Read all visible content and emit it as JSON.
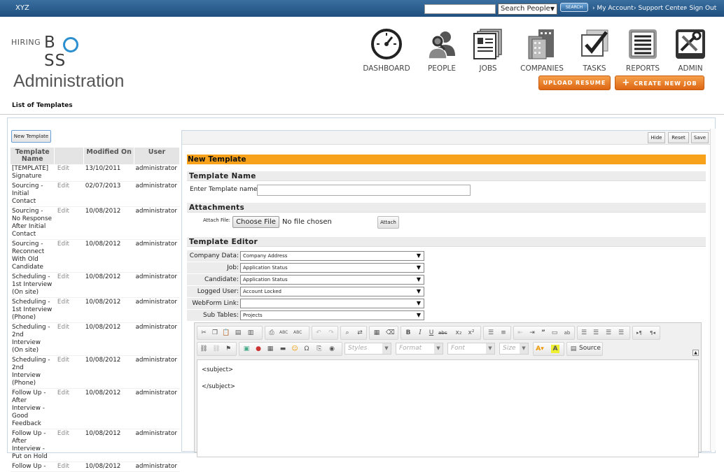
{
  "topbar": {
    "brand": "XYZ",
    "search_select": "Search People",
    "search_button": "SEARCH",
    "links": [
      "My Account",
      "Support Center",
      "Sign Out"
    ]
  },
  "logo": {
    "hiring": "HIRING",
    "boss": "B  SS"
  },
  "nav": [
    {
      "label": "DASHBOARD",
      "icon": "dashboard-icon"
    },
    {
      "label": "PEOPLE",
      "icon": "people-icon"
    },
    {
      "label": "JOBS",
      "icon": "jobs-icon"
    },
    {
      "label": "COMPANIES",
      "icon": "companies-icon"
    },
    {
      "label": "TASKS",
      "icon": "tasks-icon"
    },
    {
      "label": "REPORTS",
      "icon": "reports-icon"
    },
    {
      "label": "ADMIN",
      "icon": "admin-icon"
    }
  ],
  "page_title": "Administration",
  "buttons": {
    "upload_resume": "UPLOAD RESUME",
    "create_job": "CREATE NEW JOB"
  },
  "subtitle": "List of Templates",
  "new_template_button": "New Template",
  "table": {
    "headers": [
      "Template Name",
      "",
      "Modified On",
      "User"
    ],
    "rows": [
      {
        "name": "[TEMPLATE] Signature",
        "action": "Edit",
        "modified": "13/10/2011",
        "user": "administrator"
      },
      {
        "name": "Sourcing - Initial Contact",
        "action": "Edit",
        "modified": "02/07/2013",
        "user": "administrator"
      },
      {
        "name": "Sourcing - No Response After Initial Contact",
        "action": "Edit",
        "modified": "10/08/2012",
        "user": "administrator"
      },
      {
        "name": "Sourcing - Reconnect With Old Candidate",
        "action": "Edit",
        "modified": "10/08/2012",
        "user": "administrator"
      },
      {
        "name": "Scheduling - 1st Interview (On site)",
        "action": "Edit",
        "modified": "10/08/2012",
        "user": "administrator"
      },
      {
        "name": "Scheduling - 1st Interview (Phone)",
        "action": "Edit",
        "modified": "10/08/2012",
        "user": "administrator"
      },
      {
        "name": "Scheduling - 2nd Interview (On site)",
        "action": "Edit",
        "modified": "10/08/2012",
        "user": "administrator"
      },
      {
        "name": "Scheduling - 2nd Interview (Phone)",
        "action": "Edit",
        "modified": "10/08/2012",
        "user": "administrator"
      },
      {
        "name": "Follow Up - After Interview - Good Feedback",
        "action": "Edit",
        "modified": "10/08/2012",
        "user": "administrator"
      },
      {
        "name": "Follow Up - After Interview - Put on Hold",
        "action": "Edit",
        "modified": "10/08/2012",
        "user": "administrator"
      },
      {
        "name": "Follow Up -",
        "action": "Edit",
        "modified": "10/08/2012",
        "user": "administrator"
      }
    ]
  },
  "panel": {
    "hide": "Hide",
    "reset": "Reset",
    "save": "Save",
    "title": "New Template",
    "template_name_section": "Template Name",
    "template_name_label": "Enter Template name",
    "template_name_value": "",
    "attachments_section": "Attachments",
    "attach_file_label": "Attach File:",
    "choose_file": "Choose File",
    "no_file": "No file chosen",
    "attach_button": "Attach",
    "editor_section": "Template Editor",
    "fields": [
      {
        "label": "Company Data:",
        "value": "Company Address"
      },
      {
        "label": "Job:",
        "value": "Application Status"
      },
      {
        "label": "Candidate:",
        "value": "Application Status"
      },
      {
        "label": "Logged User:",
        "value": "Account Locked"
      },
      {
        "label": "WebForm Link:",
        "value": ""
      },
      {
        "label": "Sub Tables:",
        "value": "Projects"
      }
    ],
    "editor": {
      "styles": "Styles",
      "format": "Format",
      "font": "Font",
      "size": "Size",
      "source": "Source",
      "line1": "<subject>",
      "line2": "</subject>"
    }
  }
}
